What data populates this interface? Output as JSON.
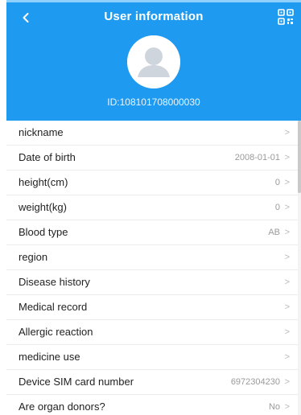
{
  "header": {
    "title": "User information",
    "user_id": "ID:108101708000030",
    "back_icon": "chevron-left-icon",
    "qr_icon": "qr-code-icon",
    "avatar_icon": "user-avatar-icon",
    "background_color": "#1e9bf0"
  },
  "fields": [
    {
      "label": "nickname",
      "value": ""
    },
    {
      "label": "Date of birth",
      "value": "2008-01-01"
    },
    {
      "label": "height(cm)",
      "value": "0"
    },
    {
      "label": "weight(kg)",
      "value": "0"
    },
    {
      "label": "Blood type",
      "value": "AB"
    },
    {
      "label": "region",
      "value": ""
    },
    {
      "label": "Disease history",
      "value": ""
    },
    {
      "label": "Medical record",
      "value": ""
    },
    {
      "label": "Allergic reaction",
      "value": ""
    },
    {
      "label": "medicine use",
      "value": ""
    },
    {
      "label": "Device SIM card number",
      "value": "6972304230"
    },
    {
      "label": "Are organ donors?",
      "value": "No"
    }
  ],
  "chevron": ">"
}
